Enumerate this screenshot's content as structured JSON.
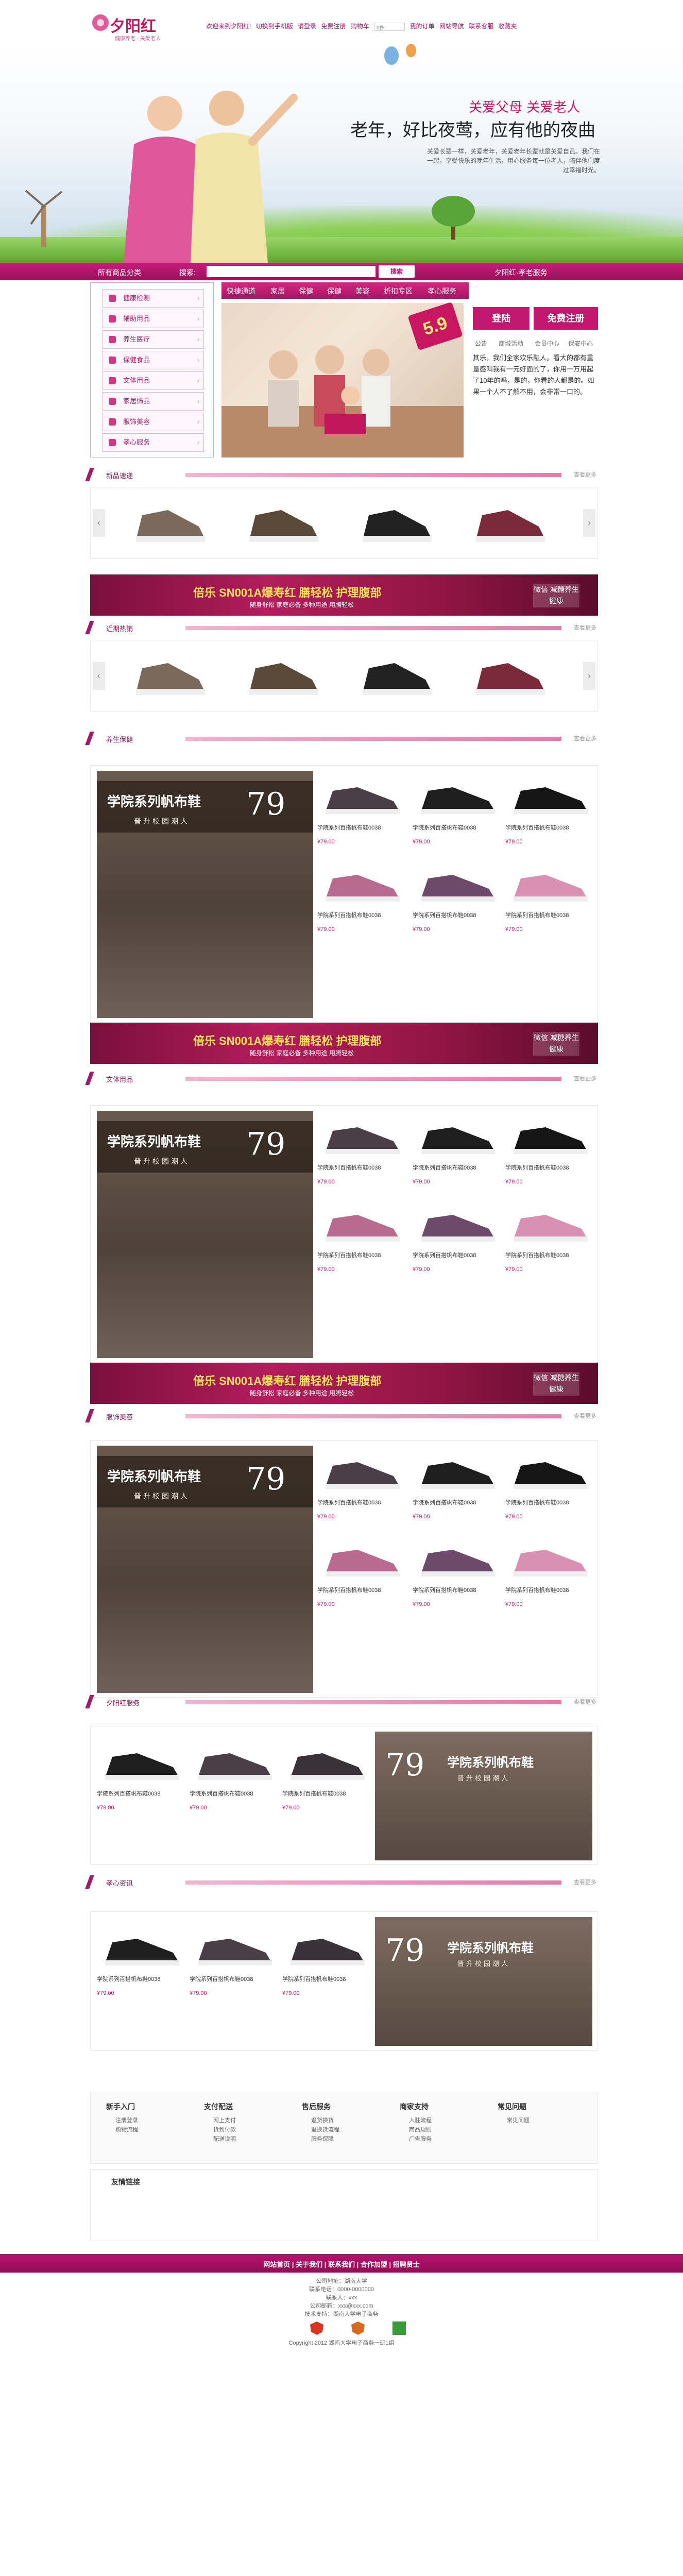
{
  "header": {
    "logo": "夕阳红",
    "logo_sub": "健康养老 · 关爱老人",
    "toplinks": [
      "欢迎来到夕阳红!",
      "切换到手机版",
      "请登录",
      "免费注册",
      "购物车",
      "我的订单",
      "网站导航",
      "联系客服",
      "收藏夹"
    ],
    "cart_select": "0件"
  },
  "banner": {
    "t1": "关爱父母 关爱老人",
    "t2": "老年，好比夜莺，应有他的夜曲",
    "t3": "关爱长辈一样，关爱老年，关爱老年长辈就是关爱自己。我们在一起，享受快乐的晚年生活，用心服务每一位老人，陪伴他们度过幸福时光。"
  },
  "nav": {
    "all": "所有商品分类",
    "search_label": "搜索:",
    "search_placeholder": "",
    "search_btn": "搜索",
    "service": "夕阳红·孝老服务"
  },
  "sidebar": {
    "items": [
      "健康检测",
      "辅助用品",
      "养生医疗",
      "保健食品",
      "文体用品",
      "家居饰品",
      "服饰美容",
      "孝心服务"
    ]
  },
  "tabs": [
    "快捷通道",
    "家居",
    "保健",
    "保健",
    "美容",
    "折扣专区",
    "孝心服务"
  ],
  "promo": {
    "badge": "5.9"
  },
  "side": {
    "reg": "登陆",
    "free": "免费注册",
    "itabs": [
      "公告",
      "商城活动",
      "会员中心",
      "保安中心"
    ],
    "text": "其乐，我们全家欢乐融人。看大的都有重量感叫我有一元好面的了，你用一万用起了10年的吗，是的，你看的人都是的。如果一个人不了解不用，会非常一口的。"
  },
  "sections": {
    "s1": "新品速递",
    "s2": "近期热销",
    "s3": "养生保健",
    "s4": "文体用品",
    "s5": "服饰美容",
    "s6": "夕阳红服务",
    "s7": "孝心资讯",
    "more": "查看更多"
  },
  "ad": {
    "t1": "倍乐 SN001A爆寿红 膳轻松 护理腹部",
    "t2": "随身舒松 家庭必备 多种用途 用腾轻松",
    "t3": "微信 减糖养生 健康"
  },
  "grid": {
    "title": "学院系列帆布鞋",
    "num": "79",
    "unit": "元起",
    "sub": "晋升校园潮人",
    "item_name": "学院系列百搭帆布鞋0038",
    "item_price": "¥79.00"
  },
  "help": [
    {
      "t": "新手入门",
      "i": [
        "注册登录",
        "购物流程"
      ]
    },
    {
      "t": "支付配送",
      "i": [
        "网上支付",
        "货到付款",
        "配送说明"
      ]
    },
    {
      "t": "售后服务",
      "i": [
        "退货换货",
        "退换货流程",
        "服务保障"
      ]
    },
    {
      "t": "商家支持",
      "i": [
        "入驻流程",
        "商品规则",
        "广告服务"
      ]
    },
    {
      "t": "常见问题",
      "i": [
        "常见问题"
      ]
    }
  ],
  "links": {
    "title": "友情链接"
  },
  "footer": {
    "bar": "网站首页 | 关于我们 | 联系我们 | 合作加盟 | 招聘贤士",
    "lines": [
      "公司地址：湖南大学",
      "联系电话：0000-0000000",
      "联系人：xxx",
      "公司邮箱：xxx@xxx.com",
      "技术支持：湖南大学电子商务",
      "Copyright 2012 湖南大学电子商务一班1组"
    ]
  }
}
